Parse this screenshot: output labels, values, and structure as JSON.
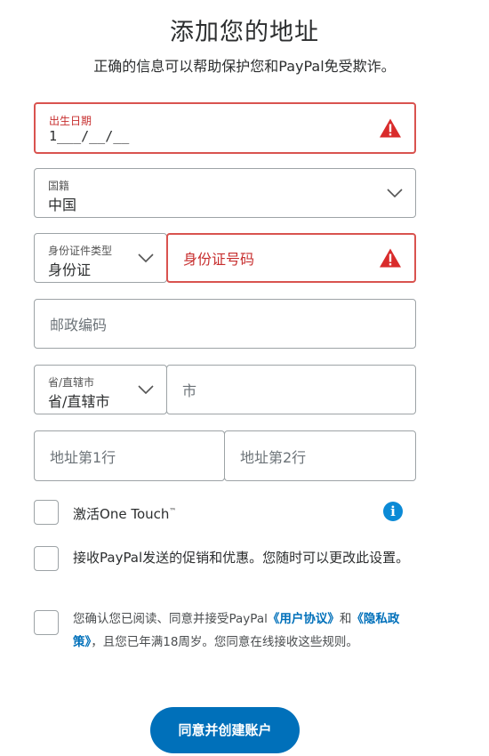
{
  "header": {
    "title": "添加您的地址",
    "subtitle": "正确的信息可以帮助保护您和PayPal免受欺诈。"
  },
  "birthdate": {
    "label": "出生日期",
    "value": "1___/__/__",
    "icon": "warning-icon"
  },
  "nationality": {
    "label": "国籍",
    "value": "中国"
  },
  "id_type": {
    "label": "身份证件类型",
    "value": "身份证"
  },
  "id_number": {
    "placeholder": "身份证号码",
    "icon": "warning-icon"
  },
  "postal_code": {
    "placeholder": "邮政编码"
  },
  "province": {
    "label": "省/直辖市",
    "value": "省/直辖市"
  },
  "city": {
    "placeholder": "市"
  },
  "address1": {
    "placeholder": "地址第1行"
  },
  "address2": {
    "placeholder": "地址第2行"
  },
  "one_touch": {
    "prefix": "激活",
    "name": "One Touch",
    "tm": "™"
  },
  "promotions": {
    "text": "接收PayPal发送的促销和优惠。您随时可以更改此设置。"
  },
  "agreement": {
    "text_1": "您确认您已阅读、同意并接受PayPal",
    "user_agreement": "《用户协议》",
    "and": "和",
    "privacy_policy": "《隐私政策》",
    "text_2": "，且您已年满18周岁。您同意在线接收这些规则。"
  },
  "submit": {
    "label": "同意并创建账户"
  },
  "colors": {
    "error": "#d9534f",
    "link": "#0070ba",
    "button": "#0070ba",
    "info": "#0b8ad6"
  }
}
